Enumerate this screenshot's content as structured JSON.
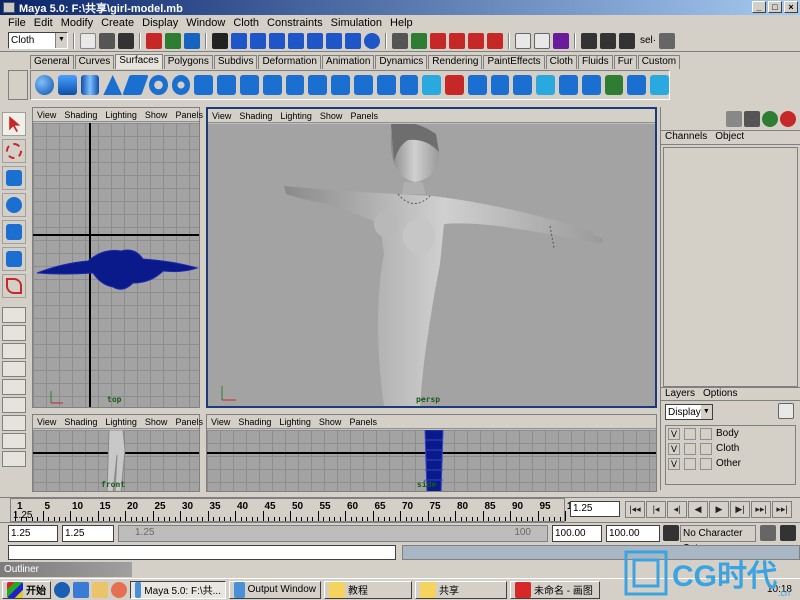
{
  "window": {
    "title": "Maya 5.0: F:\\共享\\girl-model.mb",
    "controls": [
      "_",
      "□",
      "×"
    ]
  },
  "menu": [
    "File",
    "Edit",
    "Modify",
    "Create",
    "Display",
    "Window",
    "Cloth",
    "Constraints",
    "Simulation",
    "Help"
  ],
  "status_line": {
    "menu_set": "Cloth",
    "sel_label": "sel·"
  },
  "shelf_tabs": [
    "General",
    "Curves",
    "Surfaces",
    "Polygons",
    "Subdivs",
    "Deformation",
    "Animation",
    "Dynamics",
    "Rendering",
    "PaintEffects",
    "Cloth",
    "Fluids",
    "Fur",
    "Custom"
  ],
  "active_shelf_tab": "Surfaces",
  "panel_menu": [
    "View",
    "Shading",
    "Lighting",
    "Show",
    "Panels"
  ],
  "panels": [
    {
      "id": "top",
      "camera": "top"
    },
    {
      "id": "persp",
      "camera": "persp"
    },
    {
      "id": "front",
      "camera": "front"
    },
    {
      "id": "side",
      "camera": "side"
    }
  ],
  "channel_box": {
    "tabs": [
      "Channels",
      "Object"
    ]
  },
  "layers": {
    "tabs": [
      "Layers",
      "Options"
    ],
    "display": "Display",
    "items": [
      {
        "v": "V",
        "name": "Body"
      },
      {
        "v": "V",
        "name": "Cloth"
      },
      {
        "v": "V",
        "name": "Other"
      }
    ]
  },
  "time_slider": {
    "ticks": [
      "1",
      "5",
      "10",
      "15",
      "20",
      "25",
      "30",
      "35",
      "40",
      "45",
      "50",
      "55",
      "60",
      "65",
      "70",
      "75",
      "80",
      "85",
      "90",
      "95",
      "1"
    ],
    "current_marker": "1.25",
    "current_frame": "1.25"
  },
  "playback": [
    "|◂◂",
    "|◂",
    "◂|",
    "◀",
    "▶",
    "▶|",
    "▸▸|",
    "▸▸|"
  ],
  "range": {
    "start": "1.25",
    "playback_start": "1.25",
    "track_start_label": "1.25",
    "track_end_label": "100",
    "playback_end": "100.00",
    "end": "100.00",
    "character_set": "No Character Set"
  },
  "outliner": {
    "title": "Outliner"
  },
  "taskbar": {
    "start": "开始",
    "tasks": [
      {
        "label": "Maya 5.0: F:\\共...",
        "active": true
      },
      {
        "label": "Output Window",
        "active": false
      },
      {
        "label": "教程",
        "active": false
      },
      {
        "label": "共享",
        "active": false
      },
      {
        "label": "未命名 - 画图",
        "active": false
      }
    ],
    "clock": "10:18"
  },
  "watermark": {
    "text": "CG时代",
    "url": ".cn"
  },
  "colors": {
    "title_start": "#0a246a",
    "title_end": "#a6caf0",
    "viewport_bg": "#a3a3a3",
    "active_panel_border": "#1c3b7a",
    "mesh_blue": "#0a1a8a",
    "shelf_icon_blue": "#1b6fd0"
  }
}
